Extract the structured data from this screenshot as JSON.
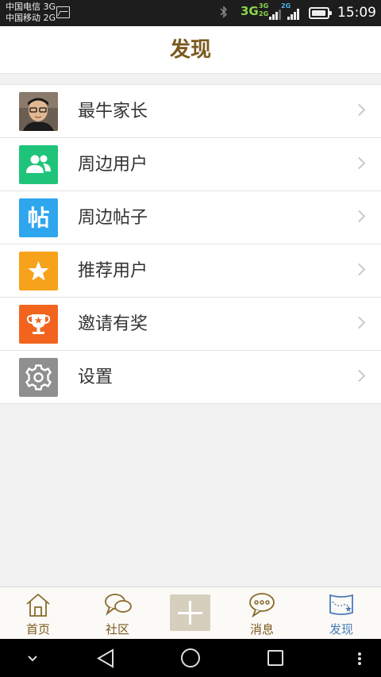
{
  "status_bar": {
    "carrier_1": "中国电信 3G",
    "carrier_2": "中国移动 2G",
    "network_main": "3G",
    "sim1_label": "3G",
    "sim2_label": "2G",
    "sim1_label_b": "2G",
    "time": "15:09"
  },
  "header": {
    "title": "发现"
  },
  "menu": {
    "items": [
      {
        "label": "最牛家长",
        "icon": "avatar-photo",
        "color": "#3a3a3a"
      },
      {
        "label": "周边用户",
        "icon": "users-icon",
        "color": "#1fc47a"
      },
      {
        "label": "周边帖子",
        "icon": "post-tie-icon",
        "color": "#2ea6ee",
        "glyph": "帖"
      },
      {
        "label": "推荐用户",
        "icon": "star-icon",
        "color": "#f7a21b"
      },
      {
        "label": "邀请有奖",
        "icon": "trophy-icon",
        "color": "#f2641e"
      },
      {
        "label": "设置",
        "icon": "gear-icon",
        "color": "#8f8f8f"
      }
    ]
  },
  "tabbar": {
    "tabs": [
      {
        "label": "首页",
        "icon": "home-icon"
      },
      {
        "label": "社区",
        "icon": "chat-bubbles-icon"
      },
      {
        "label": "",
        "icon": "plus-icon"
      },
      {
        "label": "消息",
        "icon": "message-icon"
      },
      {
        "label": "发现",
        "icon": "map-flag-icon",
        "active": true
      }
    ],
    "accent": "#7a5a1e",
    "active_color": "#4a7bb8"
  }
}
